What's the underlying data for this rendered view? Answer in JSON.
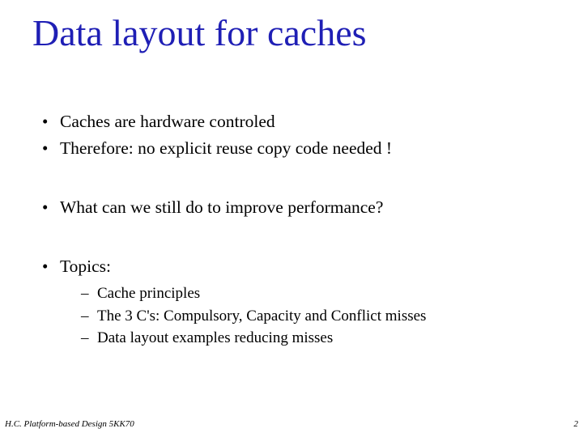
{
  "title": "Data layout for caches",
  "bullets": {
    "b1": "Caches are hardware controled",
    "b2": "Therefore: no explicit reuse copy code needed !",
    "b3": "What can we still do to improve performance?",
    "b4": "Topics:",
    "sub": {
      "s1": "Cache principles",
      "s2": "The 3 C's: Compulsory, Capacity and Conflict misses",
      "s3": "Data layout examples reducing misses"
    }
  },
  "footer": {
    "left": "H.C.   Platform-based Design 5KK70",
    "right": "2"
  }
}
